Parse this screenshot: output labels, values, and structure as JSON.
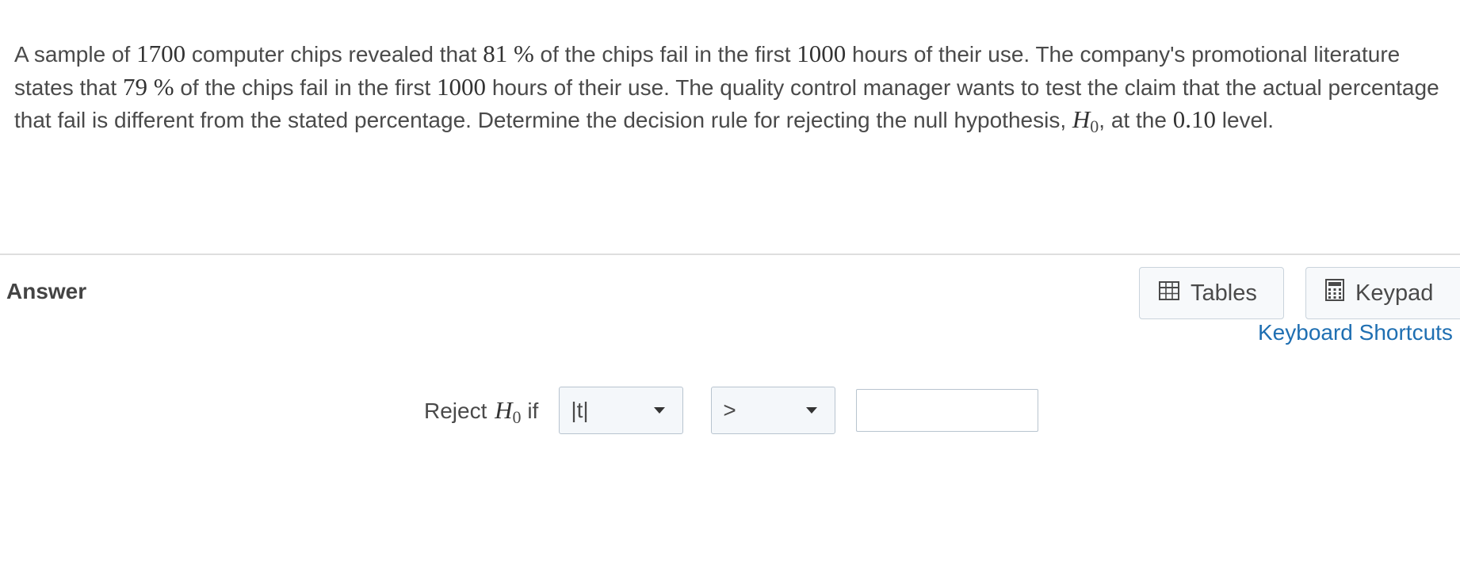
{
  "question": {
    "p1": "A sample of ",
    "n_sample": "1700",
    "p2": " computer chips revealed that ",
    "pct_observed": "81 %",
    "p3": "  of the chips fail in the first ",
    "hours1": "1000",
    "p4": " hours of their use.  The company's promotional literature states that ",
    "pct_stated": "79 %",
    "p5": "  of the chips fail in the first ",
    "hours2": "1000",
    "p6": " hours of their use.  The quality control manager wants to test the claim that the actual percentage that fail is different from the stated percentage.  Determine the decision rule for rejecting the null hypothesis, ",
    "h_letter": "H",
    "h_sub": "0",
    "p7": ", at the ",
    "alpha": "0.10",
    "p8": " level."
  },
  "answer": {
    "title": "Answer",
    "tables_label": "Tables",
    "keypad_label": "Keypad",
    "shortcuts_label": "Keyboard Shortcuts",
    "reject_prefix": "Reject ",
    "h_letter": "H",
    "h_sub": "0",
    "reject_suffix": " if",
    "statistic_select": "|t|",
    "operator_select": ">",
    "value_input": ""
  },
  "icons": {
    "tables": "table-grid-icon",
    "keypad": "calculator-icon",
    "dropdown": "caret-down-icon"
  },
  "colors": {
    "link": "#1f6fb2",
    "text": "#4a4a4a",
    "border": "#b8c4cf"
  }
}
